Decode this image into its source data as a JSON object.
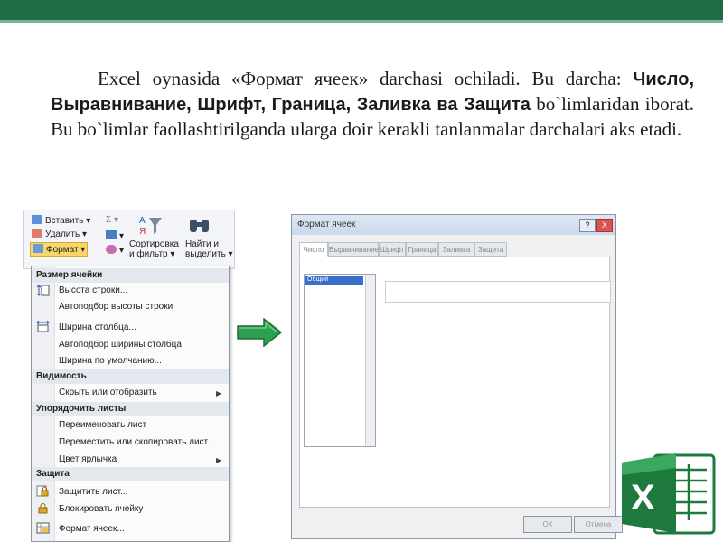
{
  "slide": {
    "text_lead": "Excel oynasida «Формат ячеек» darchasi ochiladi. Bu darcha:",
    "text_bold": "Число, Выравнивание, Шрифт, Граница, Заливка ва Защита",
    "text_tail": "bo`limlaridan iborat. Bu bo`limlar faollashtirilganda ularga doir kerakli tanlanmalar darchalari aks etadi."
  },
  "ribbon": {
    "insert": "Вставить",
    "delete": "Удалить",
    "format": "Формат",
    "sort_line1": "Сортировка",
    "sort_line2": "и фильтр",
    "find_line1": "Найти и",
    "find_line2": "выделить"
  },
  "menu": {
    "section_size": "Размер ячейки",
    "row_height": "Высота строки...",
    "autofit_row": "Автоподбор высоты строки",
    "col_width": "Ширина столбца...",
    "autofit_col": "Автоподбор ширины столбца",
    "default_width": "Ширина по умолчанию...",
    "section_visibility": "Видимость",
    "hide_show": "Скрыть или отобразить",
    "section_organize": "Упорядочить листы",
    "rename_sheet": "Переименовать лист",
    "move_copy": "Переместить или скопировать лист...",
    "tab_color": "Цвет ярлычка",
    "section_protect": "Защита",
    "protect_sheet": "Защитить лист...",
    "lock_cell": "Блокировать ячейку",
    "format_cells": "Формат ячеек..."
  },
  "dialog": {
    "title": "Формат ячеек",
    "help": "?",
    "close": "X",
    "tabs": [
      "Число",
      "Выравнивание",
      "Шрифт",
      "Граница",
      "Заливка",
      "Защита"
    ],
    "list_selected": "Общий",
    "ok": "ОК",
    "cancel": "Отмена"
  },
  "colors": {
    "accent_green": "#1f6b43",
    "arrow_green": "#2e9e4f",
    "excel_green": "#1e7a3c"
  }
}
